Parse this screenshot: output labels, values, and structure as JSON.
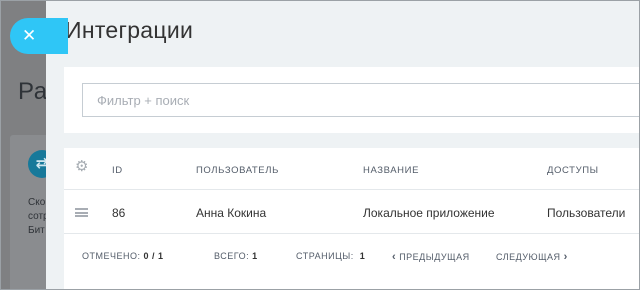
{
  "background": {
    "page_title": "Ра",
    "card_lines": [
      "Ско",
      "сотр",
      "Бит"
    ]
  },
  "slider": {
    "title": "Интеграции",
    "filter": {
      "placeholder": "Фильтр + поиск",
      "value": ""
    },
    "grid": {
      "columns": [
        "ID",
        "ПОЛЬЗОВАТЕЛЬ",
        "НАЗВАНИЕ",
        "ДОСТУПЫ"
      ],
      "rows": [
        {
          "id": "86",
          "user": "Анна Кокина",
          "name": "Локальное приложение",
          "access": "Пользователи"
        }
      ]
    },
    "footer": {
      "checked_label": "ОТМЕЧЕНО:",
      "checked_value": "0 / 1",
      "total_label": "ВСЕГО:",
      "total_value": "1",
      "pages_label": "СТРАНИЦЫ:",
      "pages_value": "1",
      "prev_label": "ПРЕДЫДУЩАЯ",
      "next_label": "СЛЕДУЮЩАЯ"
    }
  },
  "icons": {
    "close": "close-icon",
    "gear": "gear-icon",
    "drag": "drag-handle-icon",
    "prev": "chevron-left-icon",
    "next": "chevron-right-icon"
  },
  "colors": {
    "accent": "#2fc6f6",
    "overlay": "#7f8082",
    "panel": "#eef2f4"
  }
}
